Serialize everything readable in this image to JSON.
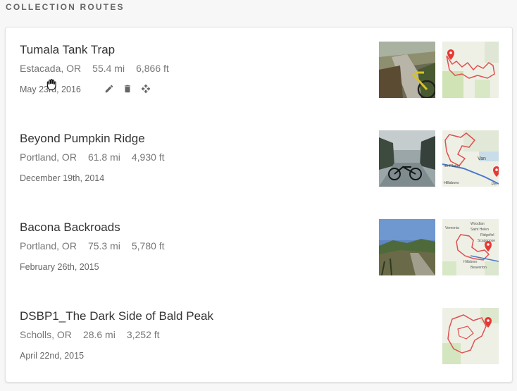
{
  "section": {
    "title": "COLLECTION ROUTES"
  },
  "routes": [
    {
      "name": "Tumala Tank Trap",
      "location": "Estacada, OR",
      "distance": "55.4 mi",
      "elevation": "6,866 ft",
      "date": "May 23rd, 2016",
      "has_photo": true
    },
    {
      "name": "Beyond Pumpkin Ridge",
      "location": "Portland, OR",
      "distance": "61.8 mi",
      "elevation": "4,930 ft",
      "date": "December 19th, 2014",
      "has_photo": true
    },
    {
      "name": "Bacona Backroads",
      "location": "Portland, OR",
      "distance": "75.3 mi",
      "elevation": "5,780 ft",
      "date": "February 26th, 2015",
      "has_photo": true
    },
    {
      "name": "DSBP1_The Dark Side of Bald Peak",
      "location": "Scholls, OR",
      "distance": "28.6 mi",
      "elevation": "3,252 ft",
      "date": "April 22nd, 2015",
      "has_photo": false
    }
  ],
  "actions": [
    "edit-icon",
    "delete-icon",
    "move-icon"
  ],
  "map_labels": {
    "route2": [
      "Van",
      "rth Plains",
      "Hillsboro",
      "Po"
    ],
    "route3": [
      "Woodlan",
      "Saint Helen",
      "Vernonia",
      "Ridgefiel",
      "Scappoose",
      "Hillsboro",
      "Beaverton"
    ]
  },
  "colors": {
    "route_line": "#e05050",
    "marker": "#e53935",
    "map_bg": "#eef0e6"
  }
}
